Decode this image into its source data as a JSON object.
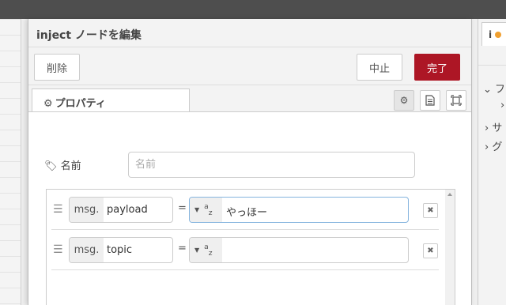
{
  "dialog": {
    "title": "inject ノードを編集",
    "delete_label": "削除",
    "cancel_label": "中止",
    "done_label": "完了"
  },
  "tabs": {
    "properties_label": "プロパティ"
  },
  "form": {
    "name_label": "名前",
    "name_placeholder": "名前",
    "name_value": ""
  },
  "properties": [
    {
      "prefix": "msg.",
      "key": "payload",
      "operator": "=",
      "type_icon": "a-z-string-icon",
      "value": "やっほー"
    },
    {
      "prefix": "msg.",
      "key": "topic",
      "operator": "=",
      "type_icon": "a-z-string-icon",
      "value": ""
    }
  ],
  "sidebar": {
    "items": [
      "フ",
      "サ",
      "グ"
    ]
  },
  "colors": {
    "primary": "#ad1625",
    "header_bar": "#4e4e4e"
  }
}
